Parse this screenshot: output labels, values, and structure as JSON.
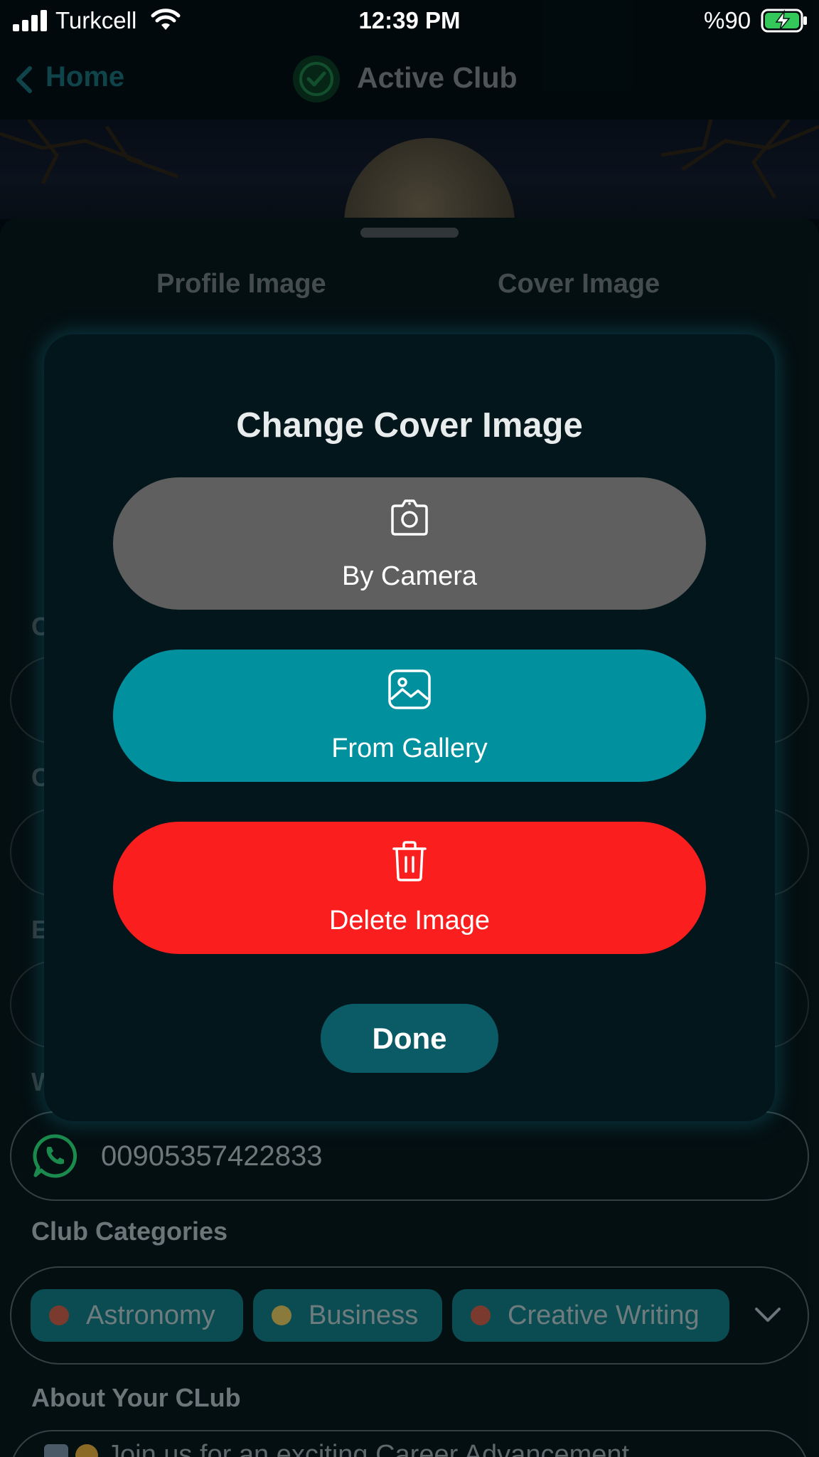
{
  "status_bar": {
    "carrier": "Turkcell",
    "time": "12:39 PM",
    "battery": "%90"
  },
  "nav": {
    "back_label": "Home",
    "title": "Active Club"
  },
  "image_section": {
    "profile_label": "Profile Image",
    "cover_label": "Cover Image"
  },
  "modal": {
    "title": "Change Cover Image",
    "options": [
      {
        "label": "By Camera",
        "icon": "camera-icon",
        "color": "#5f5f5f"
      },
      {
        "label": "From Gallery",
        "icon": "gallery-icon",
        "color": "#00909e"
      },
      {
        "label": "Delete Image",
        "icon": "trash-icon",
        "color": "#fb1e1e"
      }
    ],
    "done_label": "Done"
  },
  "background_form": {
    "partial_labels": [
      "C",
      "C",
      "E",
      "W"
    ],
    "whatsapp_value": "00905357422833",
    "categories_heading": "Club Categories",
    "categories": [
      {
        "label": "Astronomy",
        "dot_color": "#7a3a2e"
      },
      {
        "label": "Business",
        "dot_color": "#8a7a3c"
      },
      {
        "label": "Creative Writing",
        "dot_color": "#7a3a2e"
      }
    ],
    "about_heading": "About Your CLub",
    "about_text": "Join us for an exciting Career Advancement"
  }
}
